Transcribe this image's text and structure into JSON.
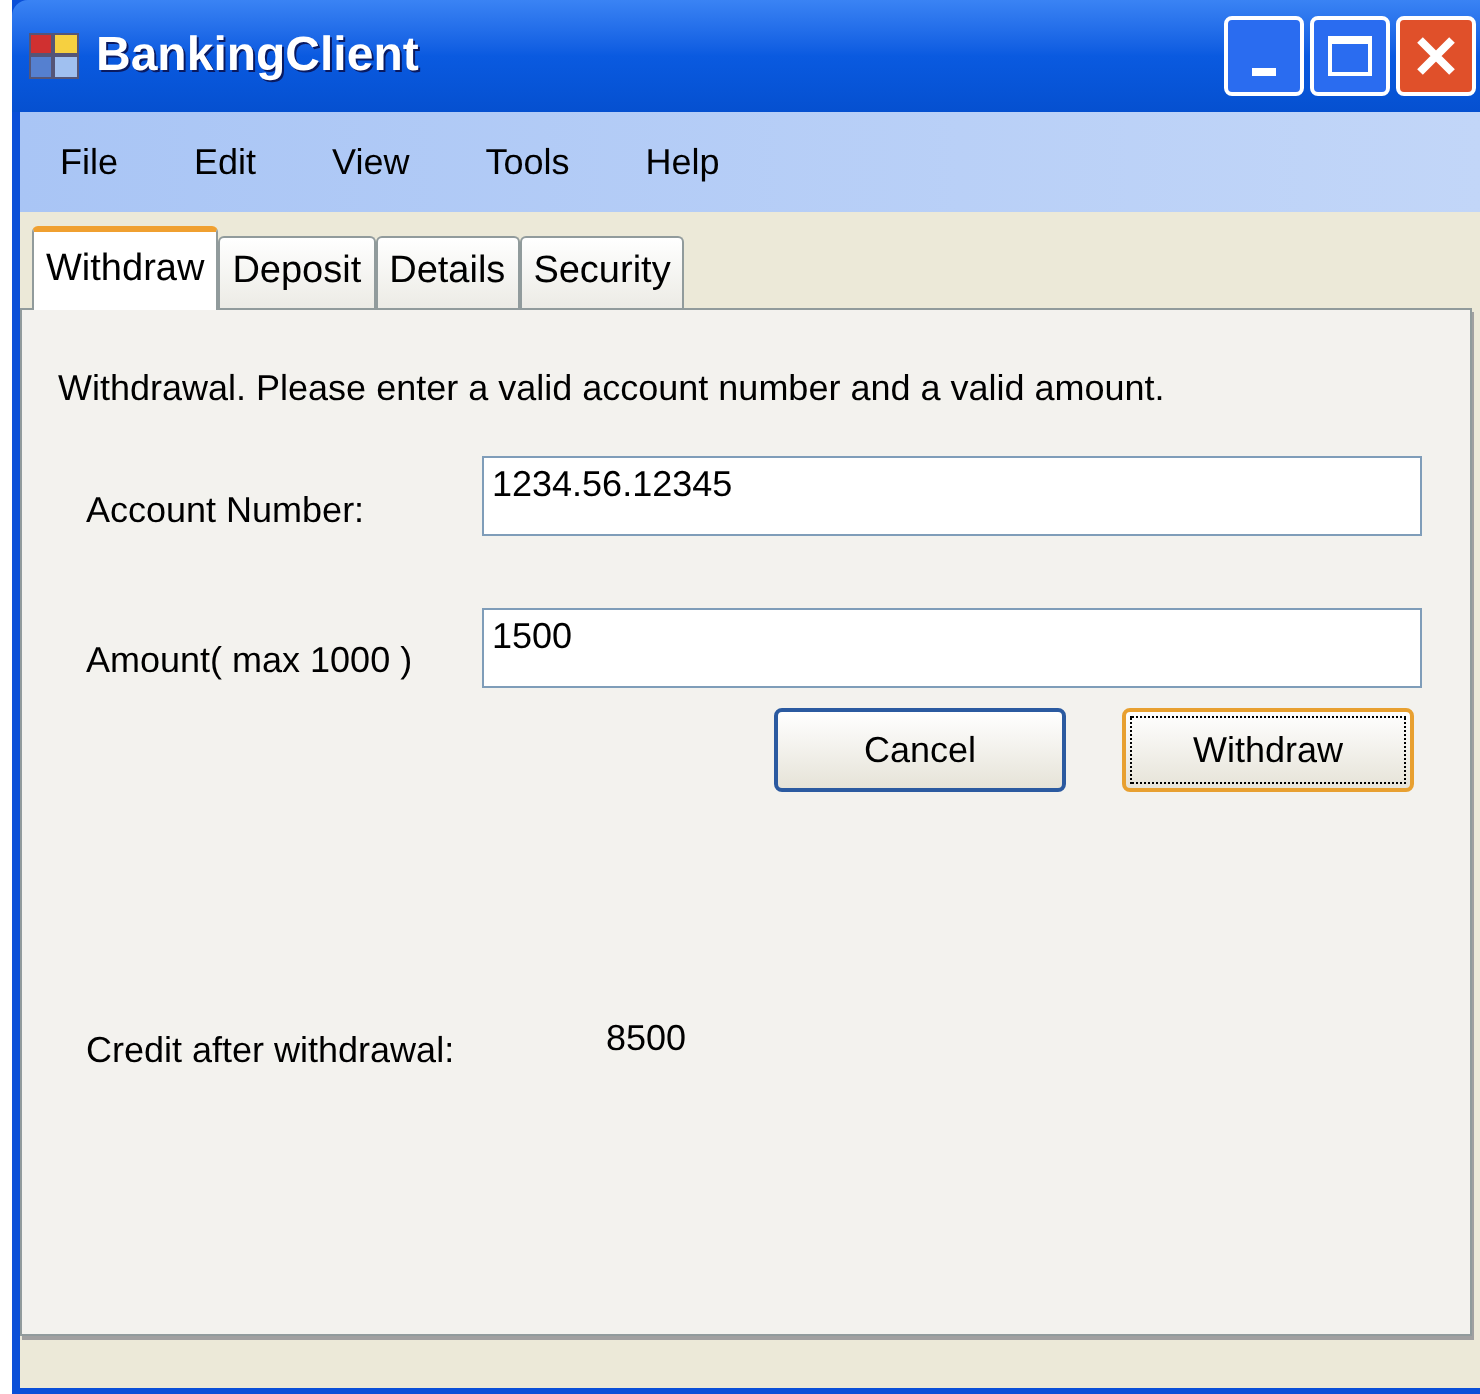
{
  "window": {
    "title": "BankingClient"
  },
  "menu": [
    "File",
    "Edit",
    "View",
    "Tools",
    "Help"
  ],
  "tabs": [
    {
      "label": "Withdraw",
      "selected": true
    },
    {
      "label": "Deposit",
      "selected": false
    },
    {
      "label": "Details",
      "selected": false
    },
    {
      "label": "Security",
      "selected": false
    }
  ],
  "instructions": "Withdrawal. Please enter a valid account number and a valid amount.",
  "fields": [
    {
      "label": "Account Number:",
      "value": "1234.56.12345"
    },
    {
      "label": "Amount( max 1000 )",
      "value": "1500"
    }
  ],
  "buttons": [
    {
      "label": "Cancel",
      "focused": false
    },
    {
      "label": "Withdraw",
      "focused": true
    }
  ],
  "result": {
    "label": "Credit after withdrawal:",
    "value": "8500"
  }
}
